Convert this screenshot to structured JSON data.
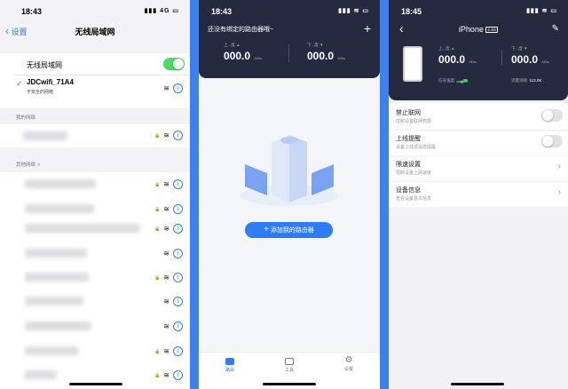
{
  "screen1": {
    "time": "18:43",
    "signal": "4G",
    "back_label": "设置",
    "title": "无线局域网",
    "wlan_label": "无线局域网",
    "connected_ssid": "JDCwifi_71A4",
    "connected_note": "不安全的网络",
    "my_networks_header": "我的网络",
    "other_networks_header": "其他网络",
    "info_glyph": "i",
    "lock_glyph": "🔒",
    "wifi_glyph": "≋"
  },
  "screen2": {
    "time": "18:43",
    "notice": "还没有绑定的路由器哦~",
    "plus": "+",
    "up_label": "上...度",
    "down_label": "下...度",
    "up_value": "000.0",
    "down_value": "000.0",
    "speed_unit": "KB/s",
    "add_router_label": "添加我的路由器",
    "add_plus": "+",
    "tabs": [
      {
        "label": "路由",
        "icon": "router-icon"
      },
      {
        "label": "工具",
        "icon": "toolbox-icon"
      },
      {
        "label": "设置",
        "icon": "gear-icon"
      }
    ]
  },
  "screen3": {
    "time": "18:45",
    "title": "iPhone",
    "band": "2.4G",
    "up_label": "上...度",
    "down_label": "下...度",
    "up_value": "000.0",
    "down_value": "000.0",
    "speed_unit": "KB/s",
    "signal_label": "信号强度:",
    "traffic_label": "流量消耗:",
    "traffic_value": "113.0K",
    "settings": [
      {
        "title": "禁止联网",
        "desc": "控制设备联网权限",
        "type": "toggle"
      },
      {
        "title": "上线提醒",
        "desc": "设备上线发消息提醒",
        "type": "toggle"
      },
      {
        "title": "限速设置",
        "desc": "限制设备上网速度",
        "type": "link"
      },
      {
        "title": "设备信息",
        "desc": "查看设备基本信息",
        "type": "link"
      }
    ]
  },
  "colors": {
    "accent": "#2f7cf6",
    "dark_panel": "#262a40",
    "toggle_on": "#4cd964",
    "frame_blue": "#3b82f0"
  }
}
